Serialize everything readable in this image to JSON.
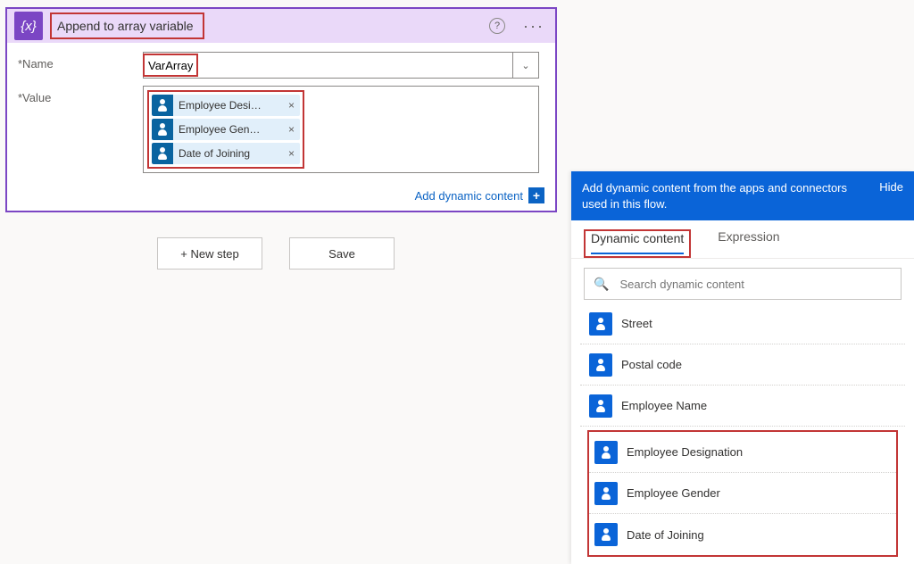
{
  "action": {
    "title": "Append to array variable",
    "icon_text": "{x}",
    "fields": {
      "name_label": "*Name",
      "value_label": "*Value"
    },
    "name_value": "VarArray",
    "value_tokens": [
      {
        "label": "Employee Desi…"
      },
      {
        "label": "Employee Gen…"
      },
      {
        "label": "Date of Joining"
      }
    ],
    "add_dynamic_label": "Add dynamic content"
  },
  "buttons": {
    "new_step": "+ New step",
    "save": "Save"
  },
  "dyn": {
    "header_text": "Add dynamic content from the apps and connectors used in this flow.",
    "hide_label": "Hide",
    "tabs": {
      "dynamic": "Dynamic content",
      "expression": "Expression"
    },
    "search_placeholder": "Search dynamic content",
    "items_top": [
      "Street",
      "Postal code",
      "Employee Name"
    ],
    "items_highlight": [
      "Employee Designation",
      "Employee Gender",
      "Date of Joining"
    ]
  }
}
